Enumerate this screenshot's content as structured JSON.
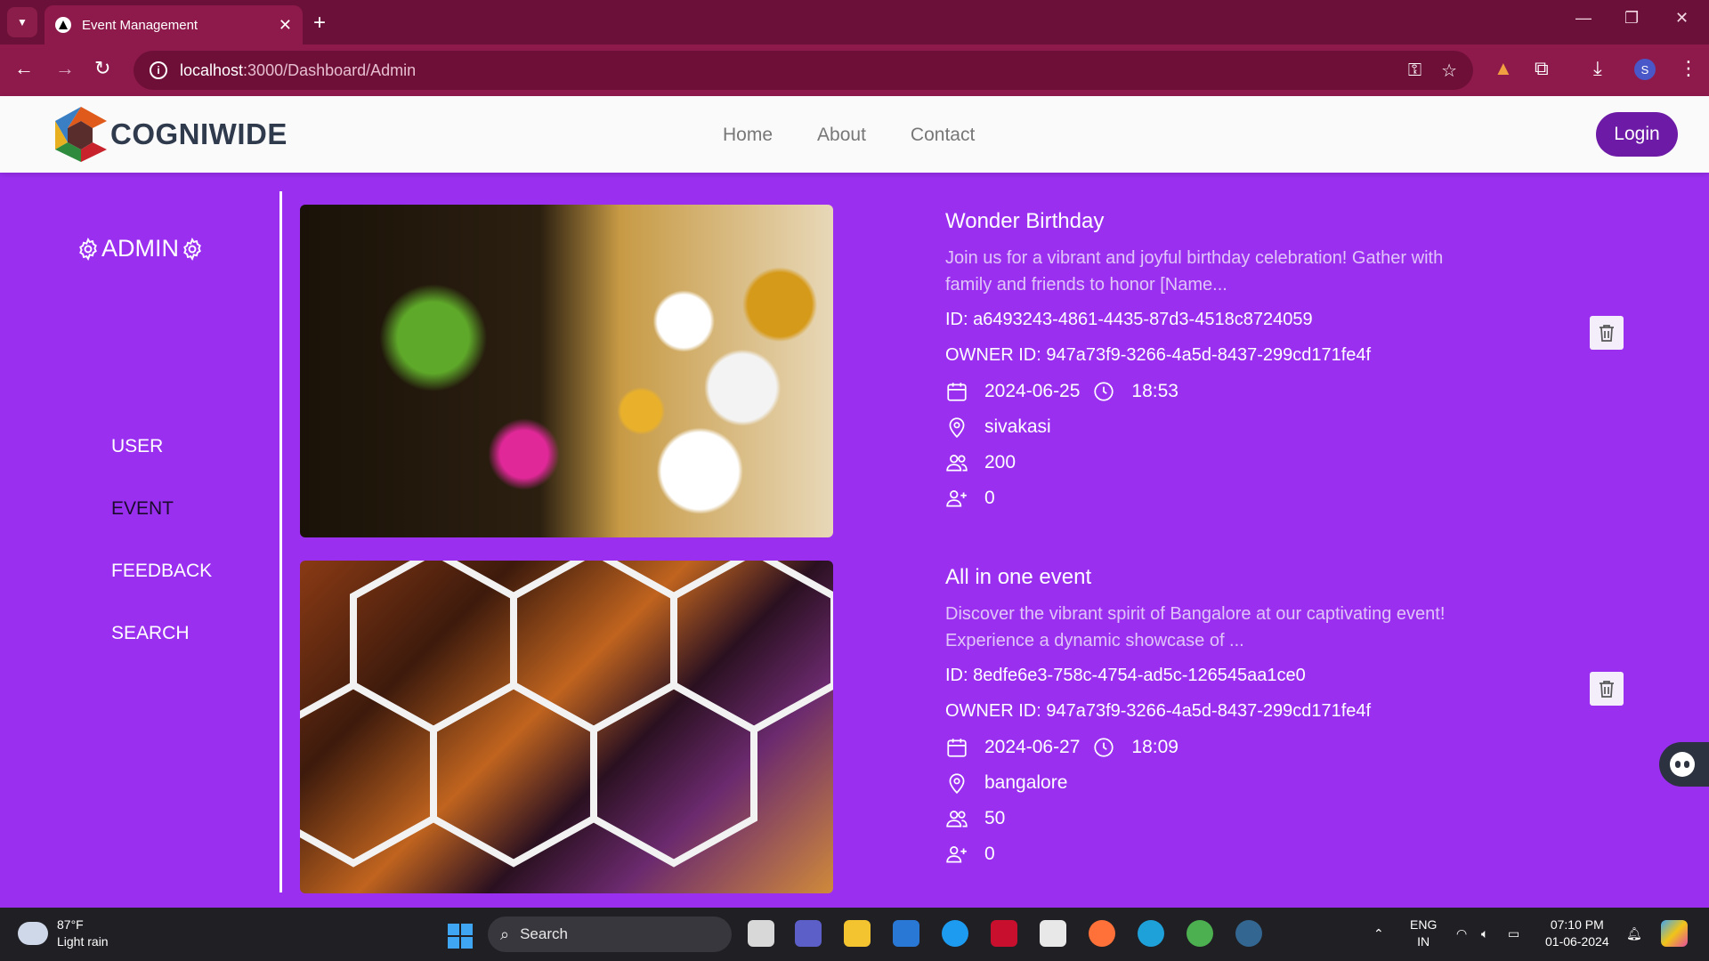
{
  "browser": {
    "tab_title": "Event Management",
    "url_host": "localhost",
    "url_path": ":3000/Dashboard/Admin"
  },
  "site": {
    "brand": "COGNIWIDE",
    "nav": [
      "Home",
      "About",
      "Contact"
    ],
    "login_label": "Login"
  },
  "sidebar": {
    "title": "ADMIN",
    "items": [
      {
        "label": "USER",
        "active": false
      },
      {
        "label": "EVENT",
        "active": true
      },
      {
        "label": "FEEDBACK",
        "active": false
      },
      {
        "label": "SEARCH",
        "active": false
      }
    ]
  },
  "events": [
    {
      "title": "Wonder Birthday",
      "description": "Join us for a vibrant and joyful birthday celebration! Gather with family and friends to honor [Name...",
      "id_line": "ID: a6493243-4861-4435-87d3-4518c8724059",
      "owner_line": "OWNER ID: 947a73f9-3266-4a5d-8437-299cd171fe4f",
      "date": "2024-06-25",
      "time": "18:53",
      "location": "sivakasi",
      "capacity": "200",
      "registered": "0"
    },
    {
      "title": "All in one event",
      "description": "Discover the vibrant spirit of Bangalore at our captivating event! Experience a dynamic showcase of ...",
      "id_line": "ID: 8edfe6e3-758c-4754-ad5c-126545aa1ce0",
      "owner_line": "OWNER ID: 947a73f9-3266-4a5d-8437-299cd171fe4f",
      "date": "2024-06-27",
      "time": "18:09",
      "location": "bangalore",
      "capacity": "50",
      "registered": "0"
    }
  ],
  "taskbar": {
    "temperature": "87°F",
    "weather": "Light rain",
    "search_placeholder": "Search",
    "lang_1": "ENG",
    "lang_2": "IN",
    "time": "07:10 PM",
    "date": "01-06-2024"
  },
  "colors": {
    "page_bg": "#9a2ff0",
    "browser_bar": "#8e1a4c",
    "login_button": "#6d1aa6"
  }
}
